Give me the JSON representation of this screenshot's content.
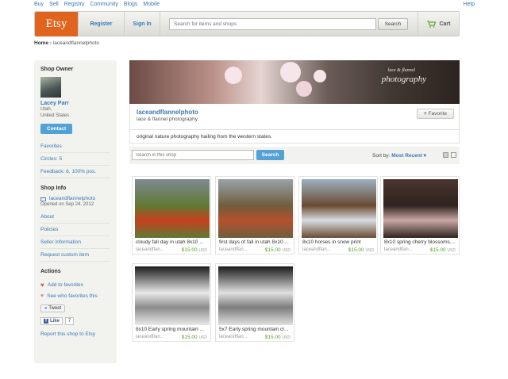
{
  "topnav": {
    "items": [
      "Buy",
      "Sell",
      "Registry",
      "Community",
      "Blogs",
      "Mobile"
    ],
    "help": "Help"
  },
  "header": {
    "logo": "Etsy",
    "register": "Register",
    "signin": "Sign In",
    "search_placeholder": "Search for items and shops",
    "search_button": "Search",
    "cart": "Cart"
  },
  "breadcrumb": {
    "home": "Home",
    "sep": "›",
    "shop": "laceandflannelphoto"
  },
  "sidebar": {
    "owner_heading": "Shop Owner",
    "owner_name": "Lacey Parr",
    "owner_loc1": "Utah,",
    "owner_loc2": "United States",
    "contact": "Contact",
    "links": [
      "Favorites",
      "Circles: 5",
      "Feedback: 6, 100% pos."
    ],
    "info_heading": "Shop Info",
    "info_shop": "laceandflannelphoto",
    "info_opened": "Opened on Sep 24, 2012",
    "info_links": [
      "About",
      "Policies",
      "Seller Information",
      "Request custom item"
    ],
    "actions_heading": "Actions",
    "add_fav": "Add to favorites",
    "see_fav": "See who favorites this",
    "tweet": "Tweet",
    "like": "Like",
    "like_count": "7",
    "report": "Report this shop to Etsy"
  },
  "banner": {
    "line1": "lace & flannel",
    "line2": "photography"
  },
  "shop": {
    "name": "laceandflannelphoto",
    "tagline": "lace & flannel photography",
    "favorite": "Favorite",
    "description": "original nature photography hailing from the western states."
  },
  "toolbar": {
    "search_placeholder": "Search in this shop",
    "search_button": "Search",
    "sort_label": "Sort by:",
    "sort_value": "Most Recent ▾"
  },
  "items": [
    {
      "title": "cloudy fall day in utah 8x10 ...",
      "shop": "laceandflan...",
      "price": "$15.00",
      "currency": "USD",
      "colors": [
        "#7f8a93",
        "#c8401f",
        "#5d7a33"
      ]
    },
    {
      "title": "first days of fall in utah 8x10 ...",
      "shop": "laceandflan...",
      "price": "$15.00",
      "currency": "USD",
      "colors": [
        "#9aa1a7",
        "#b5502d",
        "#6f5e3d"
      ]
    },
    {
      "title": "8x10 horses in snow print",
      "shop": "laceandflan...",
      "price": "$15.00",
      "currency": "USD",
      "colors": [
        "#9cb0c2",
        "#d8dde2",
        "#6b4a32"
      ]
    },
    {
      "title": "8x10 spring cherry blossoms....",
      "shop": "laceandflan...",
      "price": "$15.00",
      "currency": "USD",
      "colors": [
        "#4a3530",
        "#c9a7a4",
        "#2e2320"
      ]
    },
    {
      "title": "8x10 Early spring mountain ...",
      "shop": "laceandflan...",
      "price": "$15.00",
      "currency": "USD",
      "colors": [
        "#1c1c1c",
        "#8c8c8c",
        "#e8e8e8"
      ]
    },
    {
      "title": "5x7 Early spring mountain cr...",
      "shop": "laceandflan...",
      "price": "$15.00",
      "currency": "USD",
      "colors": [
        "#1a1a1a",
        "#7d7d7d",
        "#e0e0e0"
      ]
    }
  ]
}
